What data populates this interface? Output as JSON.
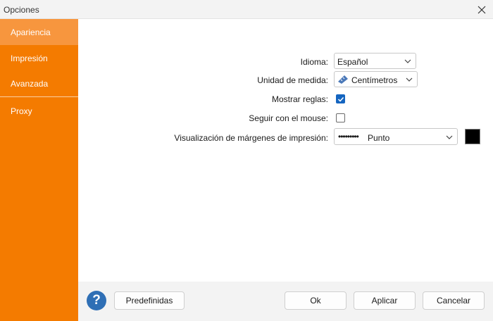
{
  "window": {
    "title": "Opciones"
  },
  "sidebar": {
    "items": [
      {
        "label": "Apariencia",
        "active": true
      },
      {
        "label": "Impresión"
      },
      {
        "label": "Avanzada"
      },
      {
        "label": "Proxy"
      }
    ]
  },
  "settings": {
    "idioma": {
      "label": "Idioma:",
      "value": "Español"
    },
    "unidad": {
      "label": "Unidad de medida:",
      "value": "Centímetros",
      "icon": "ruler-icon"
    },
    "mostrar_reglas": {
      "label": "Mostrar reglas:",
      "checked": true
    },
    "seguir_mouse": {
      "label": "Seguir con el mouse:",
      "checked": false
    },
    "margenes": {
      "label": "Visualización de márgenes de impresión:",
      "value": "Punto",
      "line_sample": "•••••••••",
      "color": "#000000"
    }
  },
  "footer": {
    "help_glyph": "?",
    "predefinidas": "Predefinidas",
    "ok": "Ok",
    "aplicar": "Aplicar",
    "cancelar": "Cancelar"
  },
  "colors": {
    "accent": "#f47b00",
    "active_item": "#f7963e",
    "checkbox": "#1565c0",
    "help": "#2f6fb5"
  }
}
